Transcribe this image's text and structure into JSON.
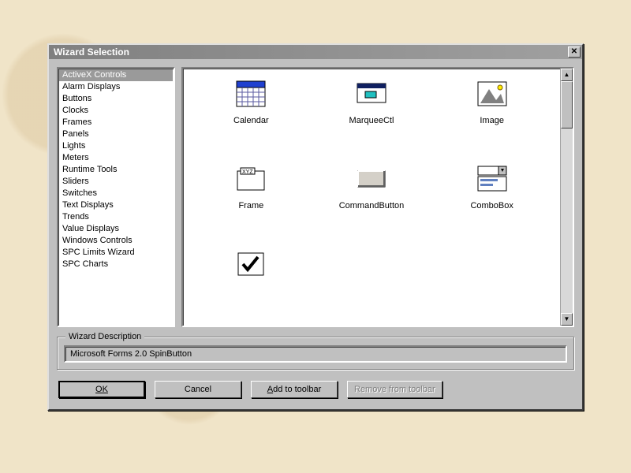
{
  "dialog": {
    "title": "Wizard Selection"
  },
  "list": {
    "selected_index": 0,
    "items": [
      "ActiveX Controls",
      "Alarm Displays",
      "Buttons",
      "Clocks",
      "Frames",
      "Panels",
      "Lights",
      "Meters",
      "Runtime Tools",
      "Sliders",
      "Switches",
      "Text Displays",
      "Trends",
      "Value Displays",
      "Windows Controls",
      "SPC Limits Wizard",
      "SPC Charts"
    ]
  },
  "controls": [
    {
      "label": "Calendar",
      "icon": "calendar-icon"
    },
    {
      "label": "MarqueeCtl",
      "icon": "marquee-icon"
    },
    {
      "label": "Image",
      "icon": "image-icon"
    },
    {
      "label": "Frame",
      "icon": "frame-icon"
    },
    {
      "label": "CommandButton",
      "icon": "button-icon"
    },
    {
      "label": "ComboBox",
      "icon": "combobox-icon"
    },
    {
      "label": "",
      "icon": "checkbox-icon"
    }
  ],
  "description": {
    "legend": "Wizard Description",
    "text": "Microsoft Forms 2.0 SpinButton"
  },
  "buttons": {
    "ok": "OK",
    "cancel": "Cancel",
    "add": "Add to toolbar",
    "remove": "Remove from toolbar"
  }
}
